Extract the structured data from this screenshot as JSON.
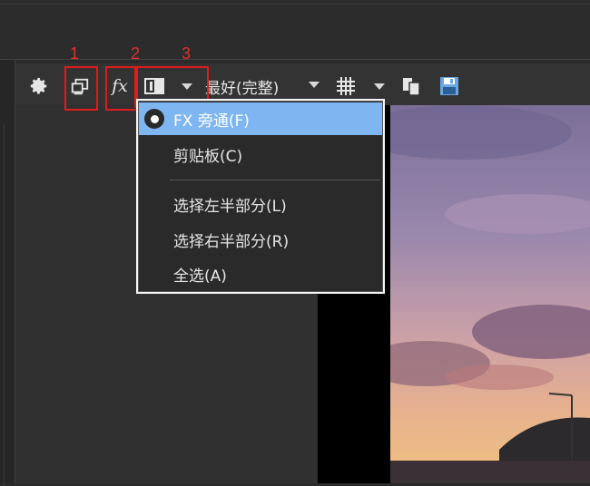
{
  "toolbar": {
    "quality_label": "最好(完整)",
    "icons": [
      "gear-icon",
      "external-monitor-icon",
      "fx-icon",
      "split-view-icon",
      "grid-icon",
      "copy-icon",
      "save-icon"
    ],
    "fx_label": "fx"
  },
  "annotations": {
    "labels": [
      "1",
      "2",
      "3"
    ]
  },
  "split_menu": {
    "items": [
      {
        "label": "FX 旁通(F)",
        "selected": true
      },
      {
        "label": "剪贴板(C)",
        "selected": false
      },
      {
        "label": "选择左半部分(L)",
        "selected": false
      },
      {
        "label": "选择右半部分(R)",
        "selected": false
      },
      {
        "label": "全选(A)",
        "selected": false
      }
    ]
  },
  "colors": {
    "highlight": "#7eb6f2",
    "annotation": "#e01b1b"
  }
}
